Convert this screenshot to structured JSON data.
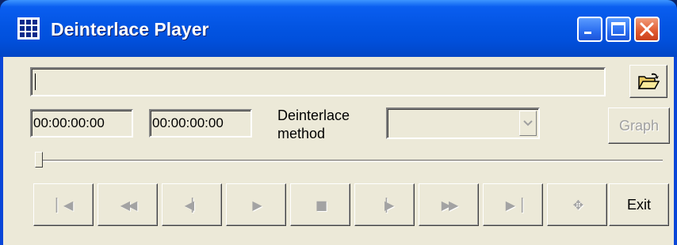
{
  "window": {
    "title": "Deinterlace Player",
    "title_color": "#ffffff",
    "titlebar_color": "#0355e3",
    "face_color": "#ECE9D8"
  },
  "file": {
    "path_value": "",
    "open_icon": "folder-open-icon"
  },
  "times": {
    "position": "00:00:00:00",
    "duration": "00:00:00:00"
  },
  "deinterlace": {
    "label": "Deinterlace method",
    "selected_value": ""
  },
  "buttons": {
    "graph_label": "Graph",
    "exit_label": "Exit"
  },
  "seek": {
    "position_fraction": 0
  },
  "transport": [
    {
      "name": "skip-to-start",
      "icon": "skip-start-icon",
      "glyph": "▏◀"
    },
    {
      "name": "rewind",
      "icon": "rewind-icon",
      "glyph": "◀◀"
    },
    {
      "name": "step-back",
      "icon": "step-back-icon",
      "glyph": "◀▏"
    },
    {
      "name": "play",
      "icon": "play-icon",
      "glyph": "▶"
    },
    {
      "name": "stop",
      "icon": "stop-icon",
      "glyph": "■"
    },
    {
      "name": "step-forward",
      "icon": "step-forward-icon",
      "glyph": "▕▶"
    },
    {
      "name": "fast-forward",
      "icon": "fast-forward-icon",
      "glyph": "▶▶"
    },
    {
      "name": "skip-to-end",
      "icon": "skip-end-icon",
      "glyph": "▶▕"
    },
    {
      "name": "zoom",
      "icon": "move-crosshair-icon",
      "glyph": "✥"
    }
  ]
}
